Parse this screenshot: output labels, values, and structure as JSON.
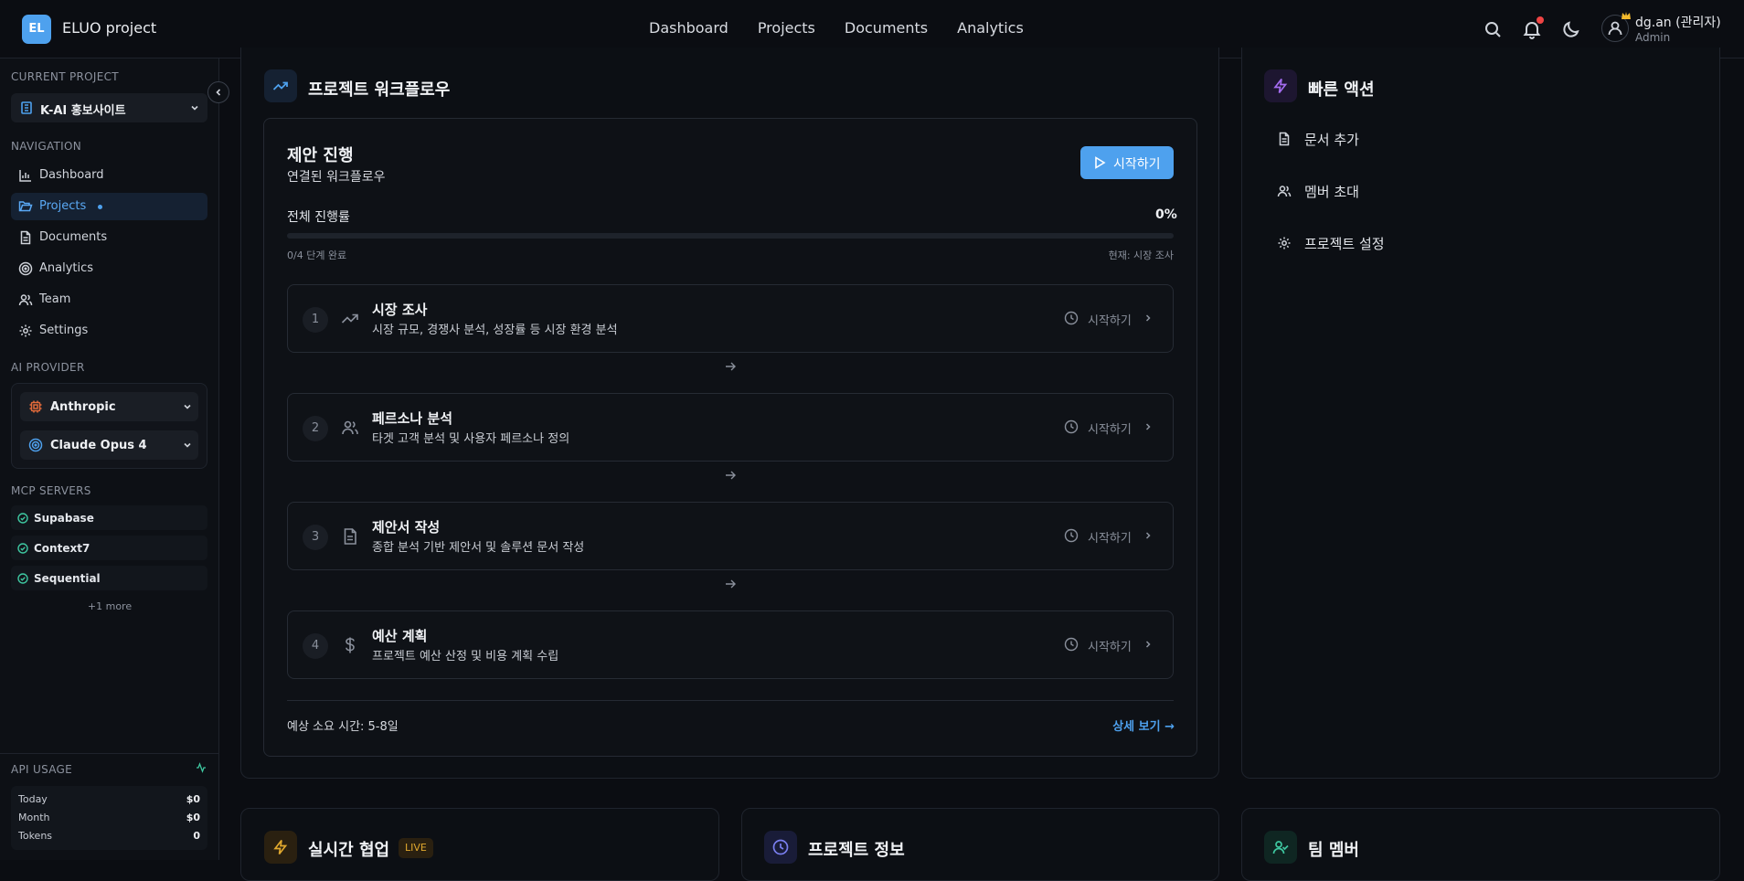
{
  "header": {
    "logo_text": "EL",
    "app_title": "ELUO project",
    "nav": [
      "Dashboard",
      "Projects",
      "Documents",
      "Analytics"
    ],
    "user_name": "dg.an (관리자)",
    "user_role": "Admin"
  },
  "sidebar": {
    "current_project_title": "CURRENT PROJECT",
    "current_project": "K-AI 홍보사이트",
    "navigation_title": "NAVIGATION",
    "nav_items": [
      {
        "label": "Dashboard",
        "icon": "bar-chart-icon"
      },
      {
        "label": "Projects",
        "icon": "folder-icon",
        "active": true
      },
      {
        "label": "Documents",
        "icon": "document-icon"
      },
      {
        "label": "Analytics",
        "icon": "target-icon"
      },
      {
        "label": "Team",
        "icon": "users-icon"
      },
      {
        "label": "Settings",
        "icon": "gear-icon"
      }
    ],
    "ai_provider_title": "AI PROVIDER",
    "ai_provider": "Anthropic",
    "ai_model": "Claude Opus 4",
    "mcp_title": "MCP SERVERS",
    "mcp_servers": [
      "Supabase",
      "Context7",
      "Sequential"
    ],
    "mcp_more": "+1 more",
    "api_usage_title": "API USAGE",
    "api_usage": [
      {
        "label": "Today",
        "value": "$0"
      },
      {
        "label": "Month",
        "value": "$0"
      },
      {
        "label": "Tokens",
        "value": "0"
      }
    ]
  },
  "workflow": {
    "title": "프로젝트 워크플로우",
    "proposal_title": "제안 진행",
    "proposal_subtitle": "연결된 워크플로우",
    "start_button": "시작하기",
    "overall_progress_label": "전체 진행률",
    "overall_progress_value": "0%",
    "progress_fraction": 0,
    "steps_done": "0/4 단계 완료",
    "current_step": "현재: 시장 조사",
    "steps": [
      {
        "num": "1",
        "title": "시장 조사",
        "desc": "시장 규모, 경쟁사 분석, 성장률 등 시장 환경 분석",
        "status": "시작하기",
        "icon": "trending-up-icon"
      },
      {
        "num": "2",
        "title": "페르소나 분석",
        "desc": "타겟 고객 분석 및 사용자 페르소나 정의",
        "status": "시작하기",
        "icon": "users-icon"
      },
      {
        "num": "3",
        "title": "제안서 작성",
        "desc": "종합 분석 기반 제안서 및 솔루션 문서 작성",
        "status": "시작하기",
        "icon": "document-icon"
      },
      {
        "num": "4",
        "title": "예산 계획",
        "desc": "프로젝트 예산 산정 및 비용 계획 수립",
        "status": "시작하기",
        "icon": "dollar-icon"
      }
    ],
    "estimated_time": "예상 소요 시간: 5-8일",
    "details_link": "상세 보기 →"
  },
  "quick_actions": {
    "title": "빠른 액션",
    "items": [
      "문서 추가",
      "멤버 초대",
      "프로젝트 설정"
    ]
  },
  "bottom_cards": {
    "realtime_title": "실시간 협업",
    "live_badge": "LIVE",
    "project_info_title": "프로젝트 정보",
    "team_title": "팀 멤버"
  },
  "colors": {
    "accent": "#4ea1ee",
    "background": "#0b0d12",
    "live": "#e0a82e",
    "quick_action_icon": "#a46cf0",
    "team_icon": "#3ec7a0",
    "provider_icon": "#e36a3a"
  }
}
